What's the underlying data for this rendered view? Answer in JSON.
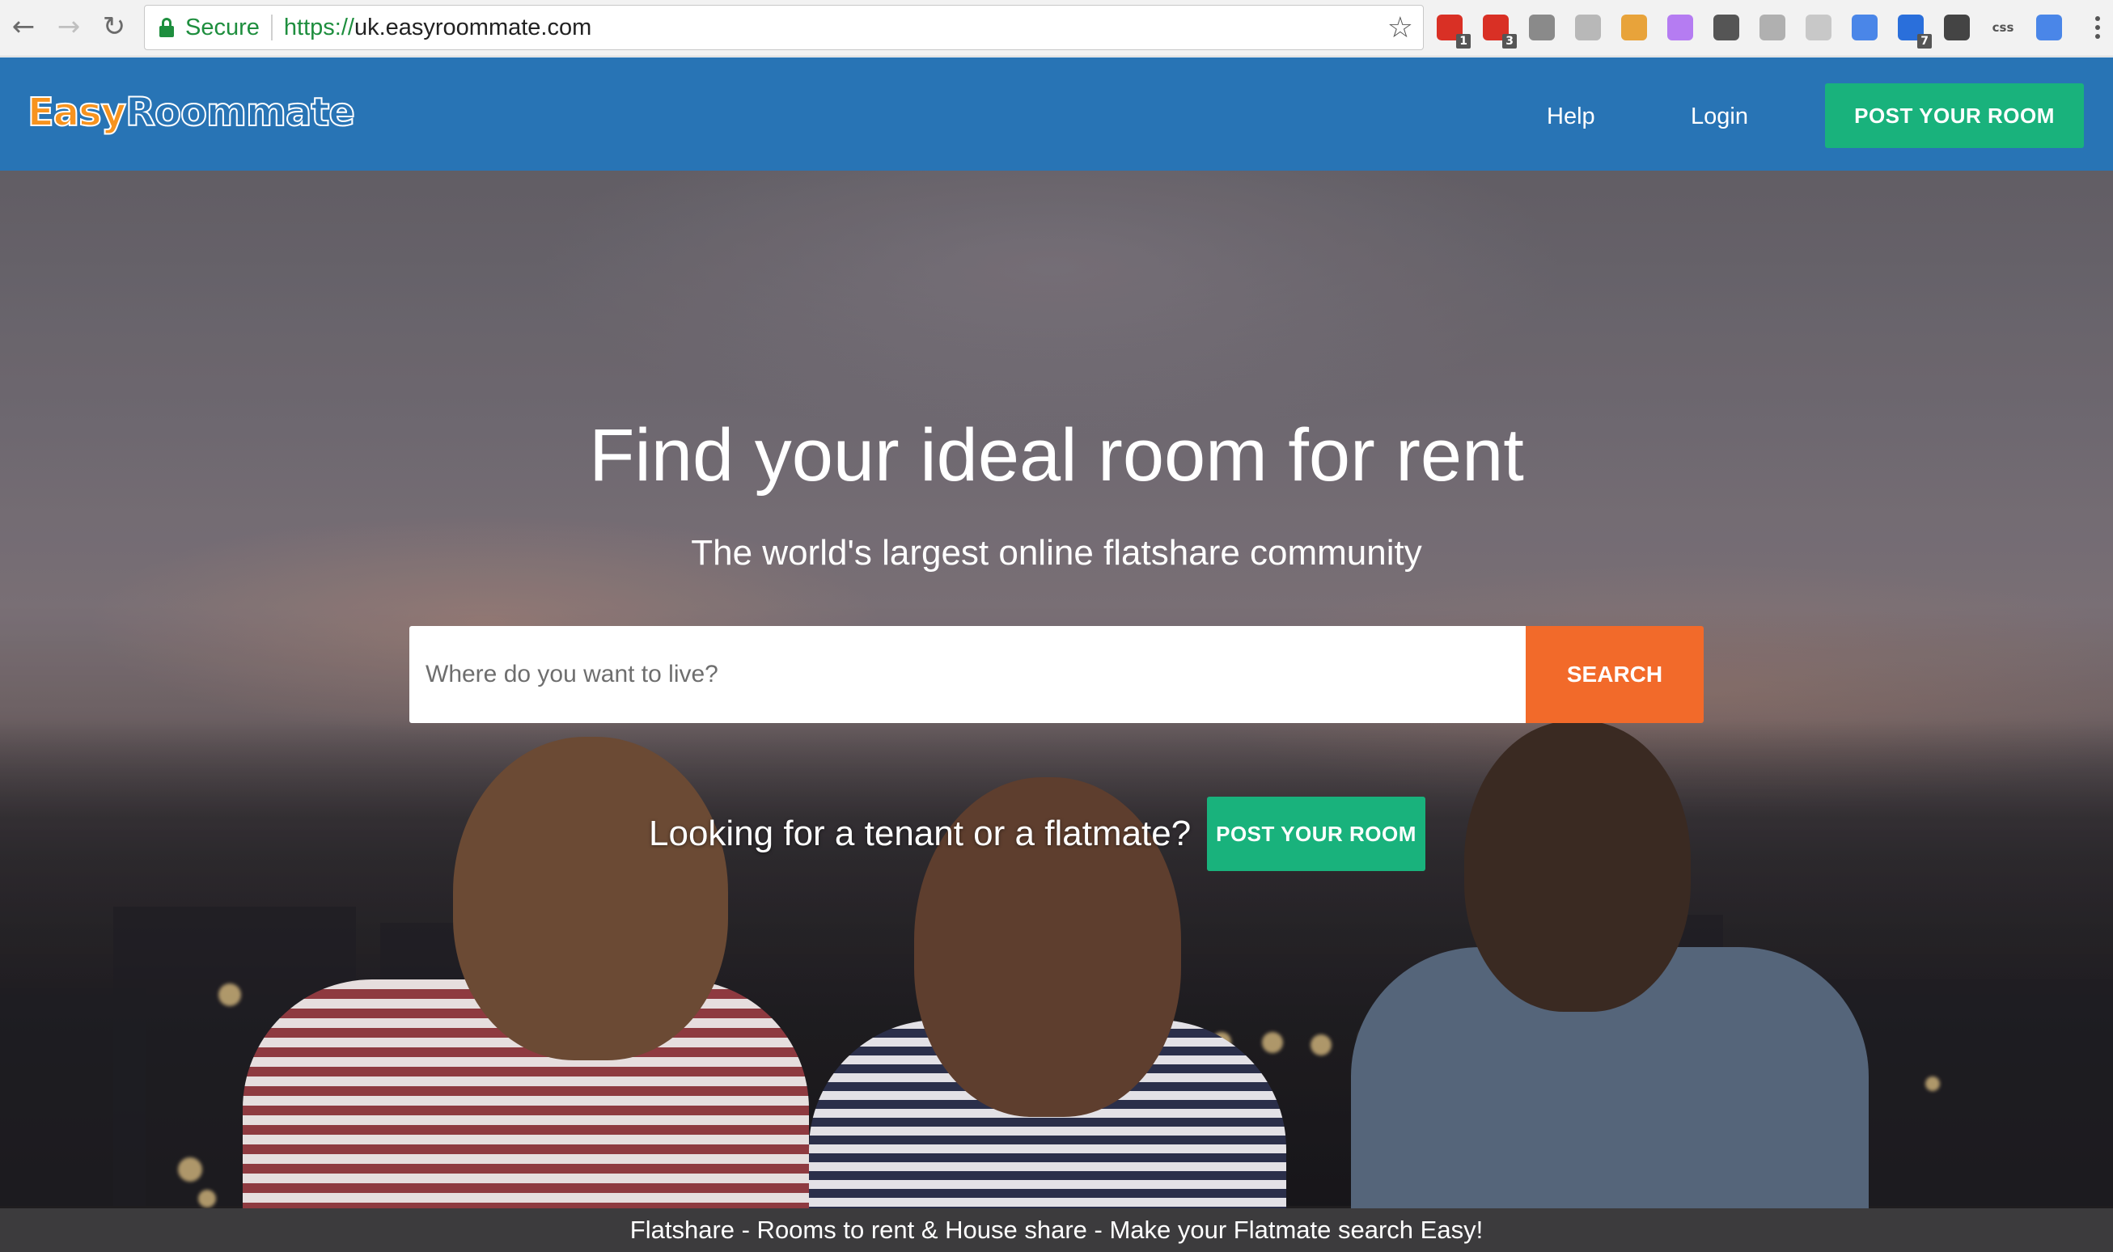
{
  "browser": {
    "secure_label": "Secure",
    "url_protocol": "https://",
    "url_host": "uk.easyroommate.com",
    "extensions": [
      {
        "name": "ext-red-badge-icon",
        "color": "#d93025",
        "badge": "1"
      },
      {
        "name": "ext-gmail-badge-icon",
        "color": "#d93025",
        "badge": "3"
      },
      {
        "name": "ext-cloud-icon",
        "color": "#8a8a8a",
        "badge": ""
      },
      {
        "name": "ext-drive-icon",
        "color": "#b8b8b8",
        "badge": ""
      },
      {
        "name": "ext-orange-icon",
        "color": "#e8a33a",
        "badge": ""
      },
      {
        "name": "ext-purple-icon",
        "color": "#b57cf2",
        "badge": ""
      },
      {
        "name": "ext-pocket-icon",
        "color": "#555555",
        "badge": ""
      },
      {
        "name": "ext-v-icon",
        "color": "#b0b0b0",
        "badge": ""
      },
      {
        "name": "ext-coin-icon",
        "color": "#c8c8c8",
        "badge": ""
      },
      {
        "name": "ext-translate-icon",
        "color": "#4a86e8",
        "badge": ""
      },
      {
        "name": "ext-blue-badge-icon",
        "color": "#2a6fdb",
        "badge": "7"
      },
      {
        "name": "ext-download-icon",
        "color": "#444444",
        "badge": ""
      },
      {
        "name": "ext-css-icon",
        "color": "#f2f2f2",
        "badge": "",
        "text": "css"
      },
      {
        "name": "cast-icon",
        "color": "#4a86e8",
        "badge": ""
      }
    ]
  },
  "header": {
    "logo_easy": "Easy",
    "logo_roommate": "Roommate",
    "nav_help": "Help",
    "nav_login": "Login",
    "cta": "POST YOUR ROOM"
  },
  "hero": {
    "title": "Find your ideal room for rent",
    "subtitle": "The world's largest online flatshare community",
    "search_placeholder": "Where do you want to live?",
    "search_button": "SEARCH",
    "tenant_question": "Looking for a tenant or a flatmate?",
    "cta": "POST YOUR ROOM"
  },
  "footer": {
    "tagline": "Flatshare - Rooms to rent & House share - Make your Flatmate search Easy!"
  },
  "colors": {
    "header_bg": "#2874b5",
    "cta_green": "#19b27c",
    "search_orange": "#f26a2a",
    "footer_bg": "#3c3b3d"
  }
}
